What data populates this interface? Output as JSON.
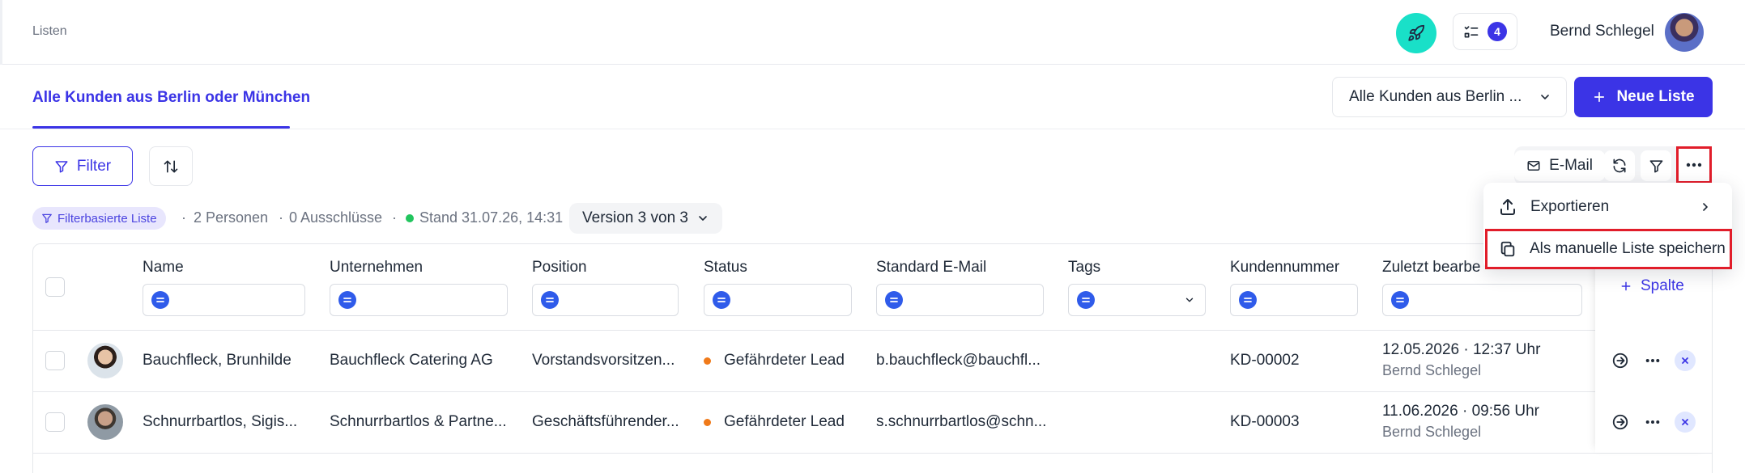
{
  "topbar": {
    "breadcrumb": "Listen",
    "tasks_count": "4",
    "user_name": "Bernd Schlegel",
    "icons": {
      "rocket": "rocket-icon",
      "tasks": "checklist-icon"
    }
  },
  "header": {
    "active_tab": "Alle Kunden aus Berlin oder München",
    "list_select_value": "Alle Kunden aus Berlin ...",
    "new_list_label": "Neue Liste"
  },
  "toolbar": {
    "filter_label": "Filter",
    "email_label": "E-Mail"
  },
  "meta": {
    "list_type": "Filterbasierte Liste",
    "persons": "2 Personen",
    "exclusions": "0 Ausschlüsse",
    "stand": "Stand 31.07.26, 14:31",
    "version": "Version 3 von 3",
    "separator": "·"
  },
  "menu": {
    "export_label": "Exportieren",
    "save_manual_label": "Als manuelle Liste speichern"
  },
  "table": {
    "columns": [
      "Name",
      "Unternehmen",
      "Position",
      "Status",
      "Standard E-Mail",
      "Tags",
      "Kundennummer",
      "Zuletzt bearbe"
    ],
    "add_column_label": "Spalte",
    "rows": [
      {
        "name": "Bauchfleck, Brunhilde",
        "company": "Bauchfleck Catering AG",
        "position": "Vorstandsvorsitzen...",
        "status": "Gefährdeter Lead",
        "email": "b.bauchfleck@bauchfl...",
        "tags": "",
        "customer_no": "KD-00002",
        "edited_date": "12.05.2026 · 12:37 Uhr",
        "edited_by": "Bernd Schlegel"
      },
      {
        "name": "Schnurrbartlos, Sigis...",
        "company": "Schnurrbartlos & Partne...",
        "position": "Geschäftsführender...",
        "status": "Gefährdeter Lead",
        "email": "s.schnurrbartlos@schn...",
        "tags": "",
        "customer_no": "KD-00003",
        "edited_date": "11.06.2026 · 09:56 Uhr",
        "edited_by": "Bernd Schlegel"
      }
    ]
  },
  "colors": {
    "accent": "#3b34e6",
    "teal": "#19e0c8",
    "status_orange": "#f07a1a",
    "highlight_red": "#e11d2a"
  }
}
